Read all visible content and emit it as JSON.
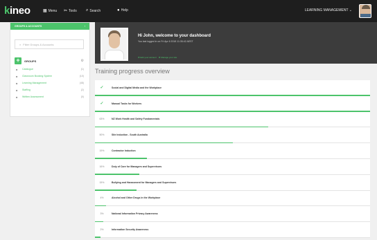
{
  "header": {
    "logo_main": "kineo",
    "logo_accent": "k",
    "nav": [
      {
        "label": "Menu",
        "icon": "grid-icon",
        "glyph": "▦"
      },
      {
        "label": "Tools",
        "icon": "wrench-icon",
        "glyph": "✂"
      },
      {
        "label": "Search",
        "icon": "search-icon",
        "glyph": "⌕"
      },
      {
        "label": "Help",
        "icon": "help-icon",
        "glyph": "●"
      }
    ],
    "user_menu": "LEARNING MANAGEMENT ⌄"
  },
  "sidebar": {
    "title": "GROUPS & ACCOUNTS",
    "collapse_glyph": "‹",
    "search_placeholder": "Filter Groups & Accounts",
    "groups_label": "GROUPS",
    "add_label": "+",
    "items": [
      {
        "name": "Catalogue",
        "count": "(1)"
      },
      {
        "name": "Classroom Booking System",
        "count": "(10)"
      },
      {
        "name": "Learning Management",
        "count": "(48)"
      },
      {
        "name": "Staffing",
        "count": "(2)"
      },
      {
        "name": "Written Assessment",
        "count": "(0)"
      }
    ]
  },
  "welcome": {
    "greeting": "Hi John, welcome to your dashboard",
    "last_login": "You last logged in on Fri Apr 6 2018 11:35:42 AEST",
    "link_edit": "Edit your account",
    "link_manage": "Manage your site"
  },
  "progress": {
    "title": "Training progress overview",
    "items": [
      {
        "status": "✓",
        "completed": true,
        "percent": 100,
        "name": "Social and Digital Media and the Workplace"
      },
      {
        "status": "✓",
        "completed": true,
        "percent": 100,
        "name": "Manual Tasks for Workers"
      },
      {
        "status": "63%",
        "completed": false,
        "percent": 63,
        "name": "NZ Work Health and Safety Fundamentals"
      },
      {
        "status": "50%",
        "completed": false,
        "percent": 50,
        "name": "Site Induction - South Australia"
      },
      {
        "status": "19%",
        "completed": false,
        "percent": 19,
        "name": "Contractor Induction"
      },
      {
        "status": "16%",
        "completed": false,
        "percent": 16,
        "name": "Duty of Care for Managers and Supervisors"
      },
      {
        "status": "15%",
        "completed": false,
        "percent": 15,
        "name": "Bullying and Harassment for Managers and Supervisors"
      },
      {
        "status": "4%",
        "completed": false,
        "percent": 4,
        "name": "Alcohol and Other Drugs in the Workplace"
      },
      {
        "status": "3%",
        "completed": false,
        "percent": 3,
        "name": "National Information Privacy Awareness"
      },
      {
        "status": "2%",
        "completed": false,
        "percent": 2,
        "name": "Information Security Awareness"
      }
    ]
  },
  "colors": {
    "accent": "#4cc36b",
    "topbar": "#1e1e1e",
    "welcome_bg": "#3c3c3c"
  }
}
